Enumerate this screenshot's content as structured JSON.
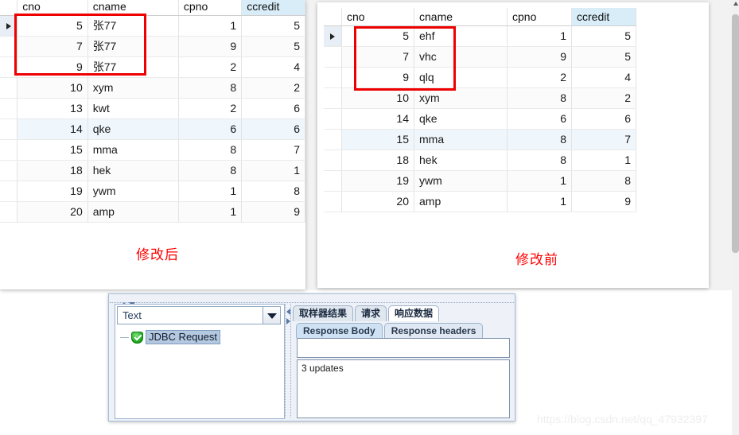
{
  "panels": {
    "left": {
      "caption": "修改后",
      "columns": [
        "cno",
        "cname",
        "cpno",
        "ccredit"
      ],
      "selected_column": "ccredit",
      "current_row_index": 0,
      "highlight_row_index": 5,
      "rows": [
        {
          "cno": "5",
          "cname": "张77",
          "cpno": "1",
          "ccredit": "5"
        },
        {
          "cno": "7",
          "cname": "张77",
          "cpno": "9",
          "ccredit": "5"
        },
        {
          "cno": "9",
          "cname": "张77",
          "cpno": "2",
          "ccredit": "4"
        },
        {
          "cno": "10",
          "cname": "xym",
          "cpno": "8",
          "ccredit": "2"
        },
        {
          "cno": "13",
          "cname": "kwt",
          "cpno": "2",
          "ccredit": "6"
        },
        {
          "cno": "14",
          "cname": "qke",
          "cpno": "6",
          "ccredit": "6"
        },
        {
          "cno": "15",
          "cname": "mma",
          "cpno": "8",
          "ccredit": "7"
        },
        {
          "cno": "18",
          "cname": "hek",
          "cpno": "8",
          "ccredit": "1"
        },
        {
          "cno": "19",
          "cname": "ywm",
          "cpno": "1",
          "ccredit": "8"
        },
        {
          "cno": "20",
          "cname": "amp",
          "cpno": "1",
          "ccredit": "9"
        }
      ]
    },
    "right": {
      "caption": "修改前",
      "columns": [
        "cno",
        "cname",
        "cpno",
        "ccredit"
      ],
      "selected_column": "ccredit",
      "current_row_index": 0,
      "highlight_row_index": 5,
      "rows": [
        {
          "cno": "5",
          "cname": "ehf",
          "cpno": "1",
          "ccredit": "5"
        },
        {
          "cno": "7",
          "cname": "vhc",
          "cpno": "9",
          "ccredit": "5"
        },
        {
          "cno": "9",
          "cname": "qlq",
          "cpno": "2",
          "ccredit": "4"
        },
        {
          "cno": "10",
          "cname": "xym",
          "cpno": "8",
          "ccredit": "2"
        },
        {
          "cno": "14",
          "cname": "qke",
          "cpno": "6",
          "ccredit": "6"
        },
        {
          "cno": "15",
          "cname": "mma",
          "cpno": "8",
          "ccredit": "7"
        },
        {
          "cno": "18",
          "cname": "hek",
          "cpno": "8",
          "ccredit": "1"
        },
        {
          "cno": "19",
          "cname": "ywm",
          "cpno": "1",
          "ccredit": "8"
        },
        {
          "cno": "20",
          "cname": "amp",
          "cpno": "1",
          "ccredit": "9"
        }
      ]
    }
  },
  "jmeter": {
    "view_combo": {
      "value": "Text",
      "arrow_icon": "chevron-down-icon"
    },
    "tree": {
      "status_icon": "green-check-shield-icon",
      "item_label": "JDBC Request"
    },
    "tabs": [
      {
        "label": "取样器结果",
        "active": false
      },
      {
        "label": "请求",
        "active": false
      },
      {
        "label": "响应数据",
        "active": true
      }
    ],
    "subtabs": [
      {
        "label": "Response Body",
        "active": true
      },
      {
        "label": "Response headers",
        "active": false
      }
    ],
    "search_field_value": "",
    "response_body_text": "3 updates"
  },
  "watermark": "https://blog.csdn.net/qq_47932397",
  "colors": {
    "annotation_red": "#ef0000",
    "selected_column": "#d9edf9",
    "highlight_row": "#eff6fc"
  }
}
